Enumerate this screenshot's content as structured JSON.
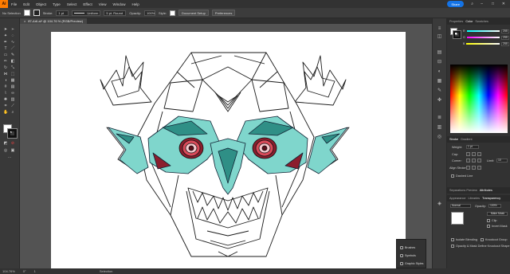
{
  "menubar": {
    "logo": "Ai",
    "items": [
      "File",
      "Edit",
      "Object",
      "Type",
      "Select",
      "Effect",
      "View",
      "Window",
      "Help"
    ],
    "share_label": "Share"
  },
  "controlbar": {
    "selection_label": "No Selection",
    "stroke_label": "Stroke:",
    "stroke_value": "1 pt",
    "profile_label": "Uniform",
    "brush_label": "5 pt. Round",
    "opacity_label": "Opacity:",
    "opacity_value": "100%",
    "style_label": "Style:",
    "doc_setup_label": "Document Setup",
    "preferences_label": "Preferences"
  },
  "document_tab": {
    "title": "ff7-ArtI.ai* @ 104.76 % (RGB/Preview)",
    "close_glyph": "×"
  },
  "statusbar": {
    "zoom": "104.76%",
    "rotation": "0°",
    "artboard_number": "1",
    "current_tool": "Selection"
  },
  "right_panel": {
    "top_tabs": [
      "Properties",
      "Color",
      "Swatches",
      "Layers"
    ],
    "active_top_tab": "Color",
    "color_values": {
      "R": "255",
      "G": "255",
      "B": "255"
    },
    "stroke_tabs": [
      "Stroke",
      "Gradient"
    ],
    "stroke_weight_label": "Weight:",
    "stroke_weight_value": "1 pt",
    "cap_label": "Cap:",
    "corner_label": "Corner:",
    "limit_label": "Limit:",
    "limit_value": "10",
    "align_stroke_label": "Align Stroke:",
    "dashed_line_label": "Dashed Line",
    "lower_tabs_1": [
      "Separations Preview",
      "Attributes"
    ],
    "lower_tabs_2": [
      "Appearance",
      "Libraries",
      "Transparency"
    ],
    "blend_mode": "Normal",
    "opacity_label": "Opacity:",
    "opacity_value": "100%",
    "make_mask_label": "Make Mask",
    "clip_label": "Clip",
    "invert_mask_label": "Invert Mask",
    "isolate_blending_label": "Isolate Blending",
    "knockout_group_label": "Knockout Group",
    "opacity_mask_label": "Opacity & Mask Define Knockout Shape"
  },
  "mini_panel": {
    "items": [
      "Brushes",
      "Symbols",
      "Graphic Styles"
    ]
  },
  "colors": {
    "app_bg": "#535353",
    "accent": "#1473e6",
    "teal": "#7fd6cc",
    "teal_dark": "#2f8f86",
    "eye_red": "#d94b5a",
    "maroon": "#8b1e2e"
  }
}
